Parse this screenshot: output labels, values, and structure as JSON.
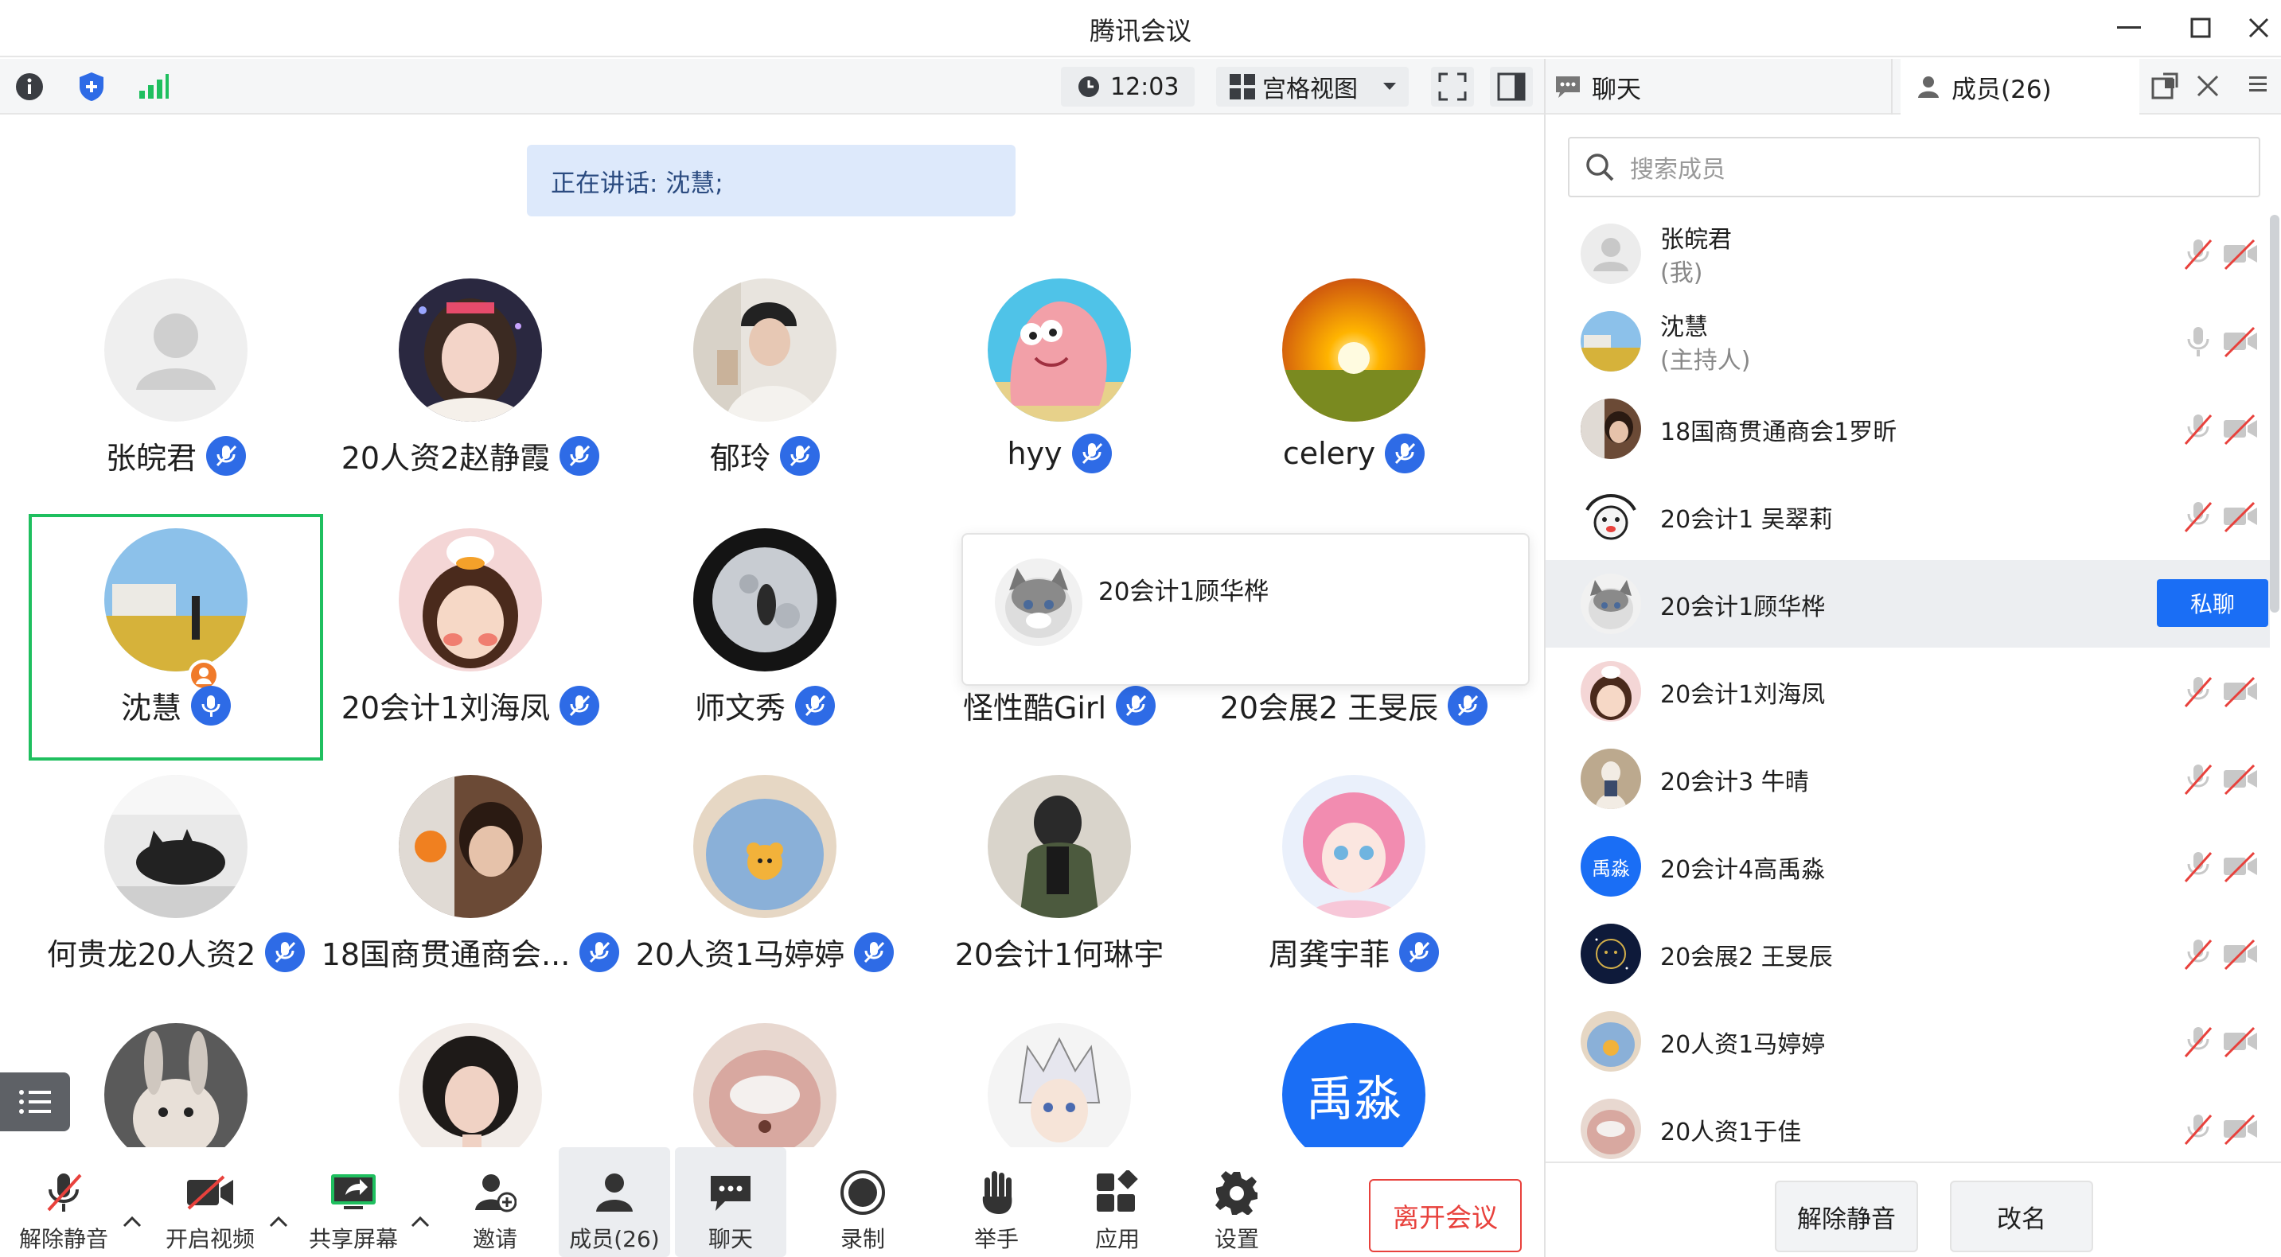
{
  "window": {
    "title": "腾讯会议"
  },
  "toolbar": {
    "time": "12:03",
    "view_label": "宫格视图"
  },
  "speaking": {
    "text": "正在讲话: 沈慧;"
  },
  "grid": {
    "row1": [
      "张皖君",
      "20人资2赵静霞",
      "郁玲",
      "hyy",
      "celery"
    ],
    "row2": [
      "沈慧",
      "20会计1刘海凤",
      "师文秀",
      "怪性酷Girl",
      "20会展2 王旻辰"
    ],
    "row3": [
      "何贵龙20人资2",
      "18国商贯通商会...",
      "20人资1马婷婷",
      "20会计1何琳宇",
      "周龚宇菲"
    ],
    "row4_avatar_text": "禹淼"
  },
  "popup": {
    "name": "20会计1顾华桦"
  },
  "bottombar": {
    "unmute": "解除静音",
    "video": "开启视频",
    "share": "共享屏幕",
    "invite": "邀请",
    "members": "成员(26)",
    "chat": "聊天",
    "record": "录制",
    "raise_hand": "举手",
    "apps": "应用",
    "settings": "设置",
    "leave": "离开会议"
  },
  "panel": {
    "tab_chat": "聊天",
    "tab_members": "成员(26)",
    "search_placeholder": "搜索成员",
    "members": [
      {
        "name": "张皖君",
        "role": "(我)"
      },
      {
        "name": "沈慧",
        "role": "(主持人)"
      },
      {
        "name": "18国商贯通商会1罗昕"
      },
      {
        "name": "20会计1 吴翠莉"
      },
      {
        "name": "20会计1顾华桦"
      },
      {
        "name": "20会计1刘海凤"
      },
      {
        "name": "20会计3 牛晴"
      },
      {
        "name": "20会计4高禹淼",
        "avatar_text": "禹淼"
      },
      {
        "name": "20会展2 王旻辰"
      },
      {
        "name": "20人资1马婷婷"
      },
      {
        "name": "20人资1于佳"
      }
    ],
    "private_chat": "私聊",
    "unmute_all": "解除静音",
    "rename": "改名"
  },
  "colors": {
    "accent": "#2e6be6",
    "leave": "#e8413c",
    "speaking_bg": "#dde9fb",
    "selected_border": "#1fbf5f"
  }
}
